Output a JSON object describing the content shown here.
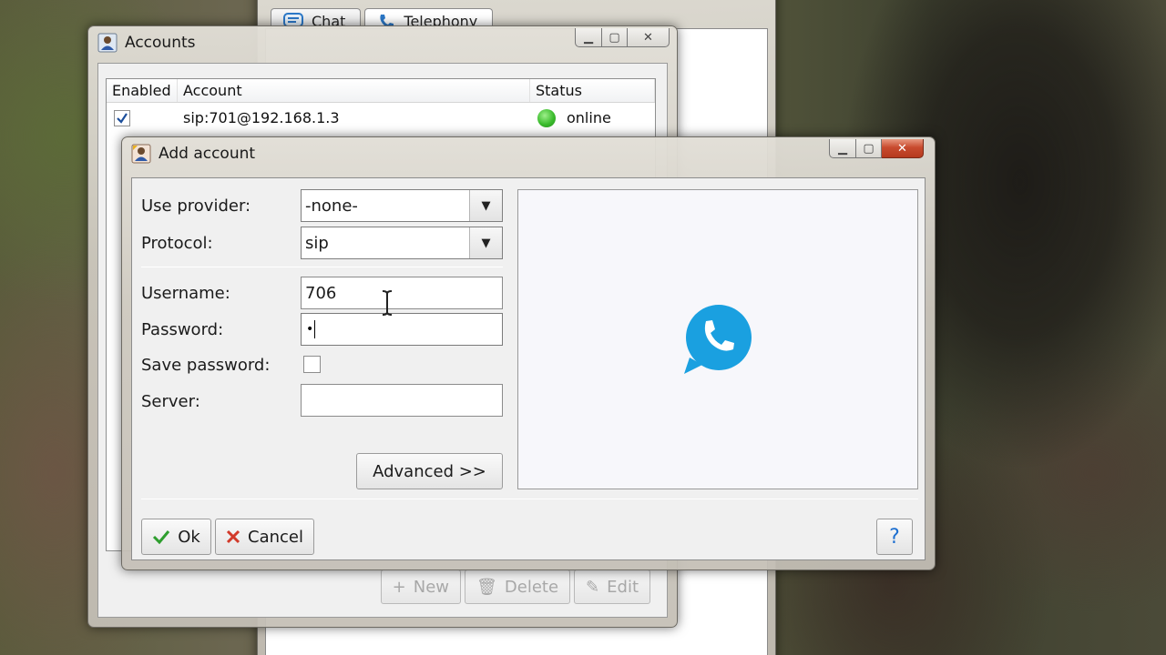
{
  "colors": {
    "online": "#3cbc2e",
    "ok_check": "#2e9e2e",
    "cancel_x": "#d23a2a",
    "help": "#1d6fd0",
    "phone_badge": "#1aa0e0"
  },
  "main_window": {
    "tabs": [
      {
        "label": "Chat",
        "icon": "chat-icon"
      },
      {
        "label": "Telephony",
        "icon": "phone-icon"
      }
    ]
  },
  "accounts": {
    "title": "Accounts",
    "columns": {
      "enabled": "Enabled",
      "account": "Account",
      "status": "Status"
    },
    "rows": [
      {
        "enabled": true,
        "account": "sip:701@192.168.1.3",
        "status": "online"
      }
    ],
    "buttons": {
      "new": "New",
      "delete": "Delete",
      "edit": "Edit"
    }
  },
  "add_account": {
    "title": "Add account",
    "provider": {
      "label": "Use provider:",
      "value": "-none-"
    },
    "protocol": {
      "label": "Protocol:",
      "value": "sip"
    },
    "username": {
      "label": "Username:",
      "value": "706"
    },
    "password": {
      "label": "Password:",
      "value": "•"
    },
    "save_password": {
      "label": "Save password:",
      "checked": false
    },
    "server": {
      "label": "Server:",
      "value": ""
    },
    "advanced_label": "Advanced >>",
    "ok_label": "Ok",
    "cancel_label": "Cancel",
    "help_label": "?"
  }
}
